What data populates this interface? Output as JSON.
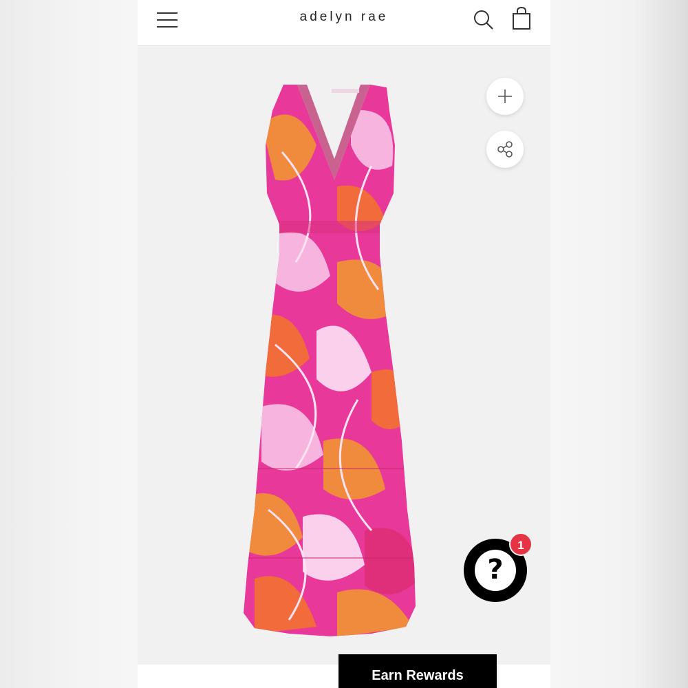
{
  "header": {
    "brand": "adelyn rae",
    "menu_icon": "hamburger-menu-icon",
    "search_icon": "search-icon",
    "bag_icon": "shopping-bag-icon"
  },
  "actions": {
    "zoom_icon": "plus-icon",
    "share_icon": "share-icon"
  },
  "help": {
    "glyph": "?",
    "badge_count": "1"
  },
  "rewards": {
    "label": "Earn Rewards"
  },
  "colors": {
    "help_badge": "#e63447",
    "dress_primary": "#e8399a",
    "dress_secondary": "#f08a3c",
    "dress_accent": "#f7b4de"
  }
}
